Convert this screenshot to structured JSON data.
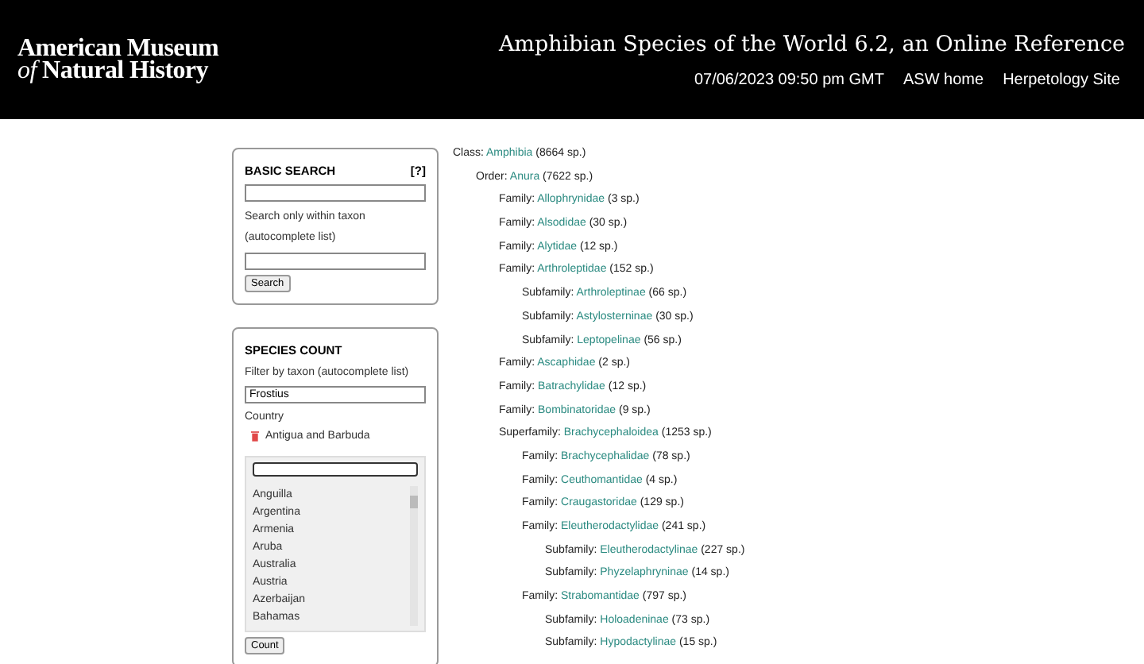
{
  "header": {
    "logo_line1": "American Museum",
    "logo_line2_italic": "of",
    "logo_line2": "Natural History",
    "site_title": "Amphibian Species of the World 6.2, an Online Reference",
    "datetime": "07/06/2023 09:50 pm GMT",
    "links": [
      "ASW home",
      "Herpetology Site"
    ]
  },
  "basic_search": {
    "title": "BASIC SEARCH",
    "help": "[?]",
    "hint": "Search only within taxon (autocomplete list)",
    "button": "Search"
  },
  "species_count": {
    "title": "SPECIES COUNT",
    "filter_label": "Filter by taxon (autocomplete list)",
    "filter_value": "Frostius",
    "country_label": "Country",
    "chosen": [
      "Antigua and Barbuda"
    ],
    "options": [
      {
        "label": "Anguilla",
        "selected": false
      },
      {
        "label": "Argentina",
        "selected": false
      },
      {
        "label": "Armenia",
        "selected": false
      },
      {
        "label": "Aruba",
        "selected": false
      },
      {
        "label": "Australia",
        "selected": false
      },
      {
        "label": "Austria",
        "selected": false
      },
      {
        "label": "Azerbaijan",
        "selected": false
      },
      {
        "label": "Bahamas",
        "selected": false
      }
    ],
    "button": "Count"
  },
  "tree": [
    {
      "rank": "Class:",
      "name": "Amphibia",
      "count": "(8664 sp.)",
      "children": [
        {
          "rank": "Order:",
          "name": "Anura",
          "count": "(7622 sp.)",
          "children": [
            {
              "rank": "Family:",
              "name": "Allophrynidae",
              "count": "(3 sp.)"
            },
            {
              "rank": "Family:",
              "name": "Alsodidae",
              "count": "(30 sp.)"
            },
            {
              "rank": "Family:",
              "name": "Alytidae",
              "count": "(12 sp.)"
            },
            {
              "rank": "Family:",
              "name": "Arthroleptidae",
              "count": "(152 sp.)",
              "children": [
                {
                  "rank": "Subfamily:",
                  "name": "Arthroleptinae",
                  "count": "(66 sp.)"
                },
                {
                  "rank": "Subfamily:",
                  "name": "Astylosterninae",
                  "count": "(30 sp.)"
                },
                {
                  "rank": "Subfamily:",
                  "name": "Leptopelinae",
                  "count": "(56 sp.)"
                }
              ]
            },
            {
              "rank": "Family:",
              "name": "Ascaphidae",
              "count": "(2 sp.)"
            },
            {
              "rank": "Family:",
              "name": "Batrachylidae",
              "count": "(12 sp.)"
            },
            {
              "rank": "Family:",
              "name": "Bombinatoridae",
              "count": "(9 sp.)"
            },
            {
              "rank": "Superfamily:",
              "name": "Brachycephaloidea",
              "count": "(1253 sp.)",
              "children": [
                {
                  "rank": "Family:",
                  "name": "Brachycephalidae",
                  "count": "(78 sp.)"
                },
                {
                  "rank": "Family:",
                  "name": "Ceuthomantidae",
                  "count": "(4 sp.)"
                },
                {
                  "rank": "Family:",
                  "name": "Craugastoridae",
                  "count": "(129 sp.)"
                },
                {
                  "rank": "Family:",
                  "name": "Eleutherodactylidae",
                  "count": "(241 sp.)",
                  "children": [
                    {
                      "rank": "Subfamily:",
                      "name": "Eleutherodactylinae",
                      "count": "(227 sp.)"
                    },
                    {
                      "rank": "Subfamily:",
                      "name": "Phyzelaphryninae",
                      "count": "(14 sp.)"
                    }
                  ]
                },
                {
                  "rank": "Family:",
                  "name": "Strabomantidae",
                  "count": "(797 sp.)",
                  "children": [
                    {
                      "rank": "Subfamily:",
                      "name": "Holoadeninae",
                      "count": "(73 sp.)"
                    },
                    {
                      "rank": "Subfamily:",
                      "name": "Hypodactylinae",
                      "count": "(15 sp.)"
                    }
                  ]
                }
              ]
            }
          ]
        }
      ]
    }
  ]
}
